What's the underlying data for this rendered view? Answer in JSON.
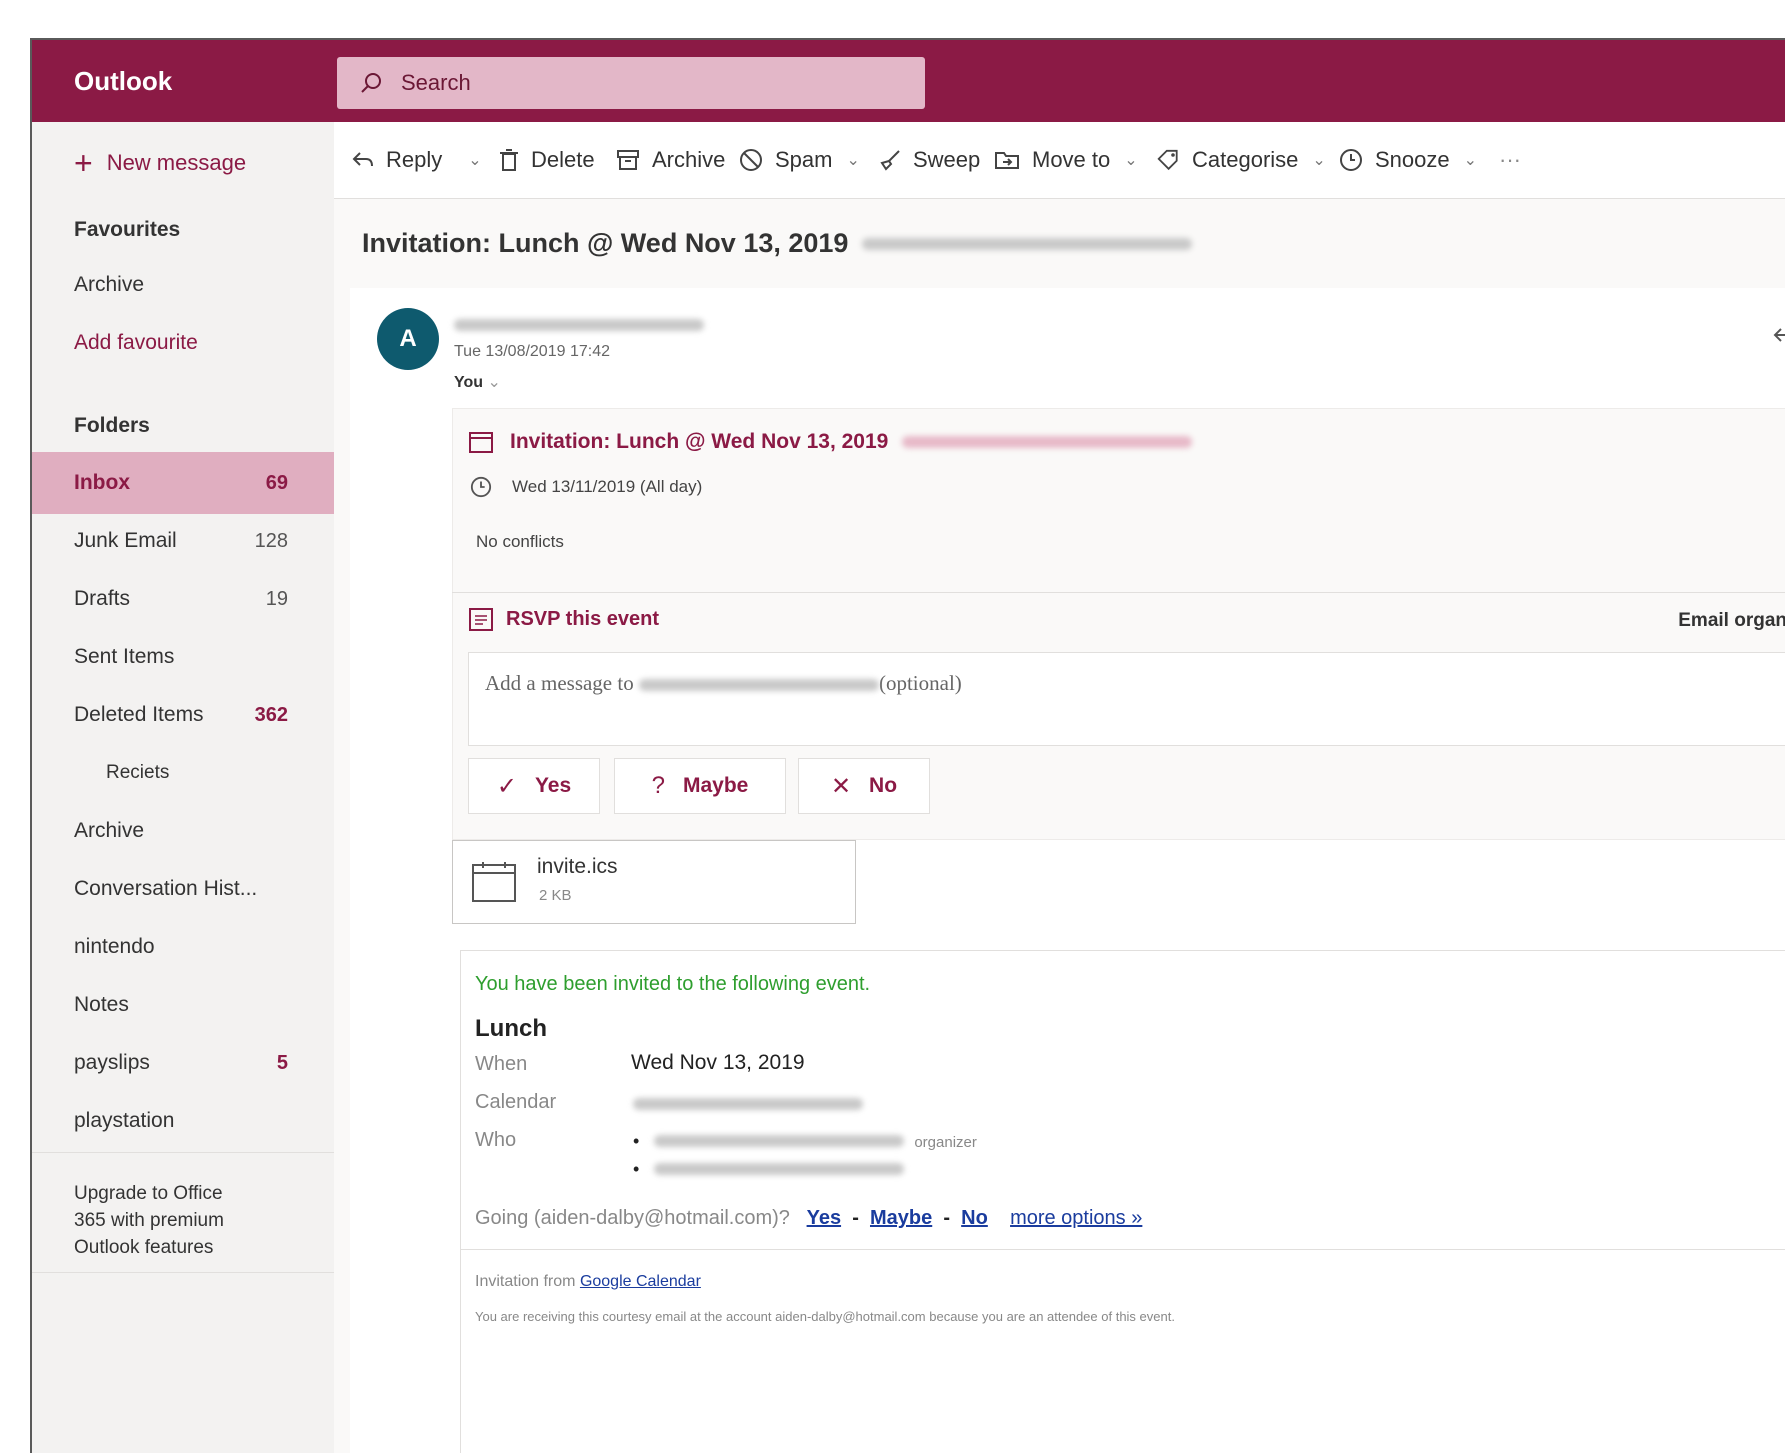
{
  "app": {
    "title": "Outlook"
  },
  "search": {
    "placeholder": "Search"
  },
  "nav": {
    "new_message": "New message",
    "favourites_heading": "Favourites",
    "fav_archive": "Archive",
    "add_favourite": "Add favourite",
    "folders_heading": "Folders",
    "folders": [
      {
        "label": "Inbox",
        "count": "69"
      },
      {
        "label": "Junk Email",
        "count": "128"
      },
      {
        "label": "Drafts",
        "count": "19"
      },
      {
        "label": "Sent Items",
        "count": ""
      },
      {
        "label": "Deleted Items",
        "count": "362"
      },
      {
        "label": "Reciets",
        "count": ""
      },
      {
        "label": "Archive",
        "count": ""
      },
      {
        "label": "Conversation Hist...",
        "count": ""
      },
      {
        "label": "nintendo",
        "count": ""
      },
      {
        "label": "Notes",
        "count": ""
      },
      {
        "label": "payslips",
        "count": "5"
      },
      {
        "label": "playstation",
        "count": ""
      }
    ],
    "upgrade": [
      "Upgrade to Office",
      "365 with premium",
      "Outlook features"
    ]
  },
  "toolbar": {
    "reply": "Reply",
    "delete": "Delete",
    "archive": "Archive",
    "spam": "Spam",
    "sweep": "Sweep",
    "move_to": "Move to",
    "categorise": "Categorise",
    "snooze": "Snooze",
    "more": "···"
  },
  "message": {
    "subject": "Invitation: Lunch @ Wed Nov 13, 2019",
    "avatar_initial": "A",
    "timestamp": "Tue 13/08/2019 17:42",
    "to": "You",
    "invite_title": "Invitation: Lunch @ Wed Nov 13, 2019",
    "invite_time": "Wed 13/11/2019 (All day)",
    "conflicts": "No conflicts",
    "rsvp_label": "RSVP this event",
    "email_organiser": "Email organ",
    "message_placeholder_prefix": "Add a message to",
    "message_placeholder_suffix": "(optional)",
    "rsvp_yes": "Yes",
    "rsvp_maybe": "Maybe",
    "rsvp_no": "No",
    "attachment_name": "invite.ics",
    "attachment_size": "2 KB"
  },
  "gcal": {
    "invited_text": "You have been invited to the following event.",
    "event_title": "Lunch",
    "when_label": "When",
    "when_value": "Wed Nov 13, 2019",
    "calendar_label": "Calendar",
    "who_label": "Who",
    "organizer_tag": "organizer",
    "going_text": "Going (aiden-dalby@hotmail.com)?",
    "going_yes": "Yes",
    "going_maybe": "Maybe",
    "going_no": "No",
    "more_options": "more options »",
    "invitation_from": "Invitation from",
    "google_calendar": "Google Calendar",
    "courtesy_text": "You are receiving this courtesy email at the account aiden-dalby@hotmail.com because you are an attendee of this event."
  },
  "colors": {
    "brand": "#8b1a45",
    "selected": "#e0aec0",
    "avatar": "#0e5a6e",
    "invited_green": "#2e9e2e",
    "link_blue": "#1a3c9e"
  }
}
